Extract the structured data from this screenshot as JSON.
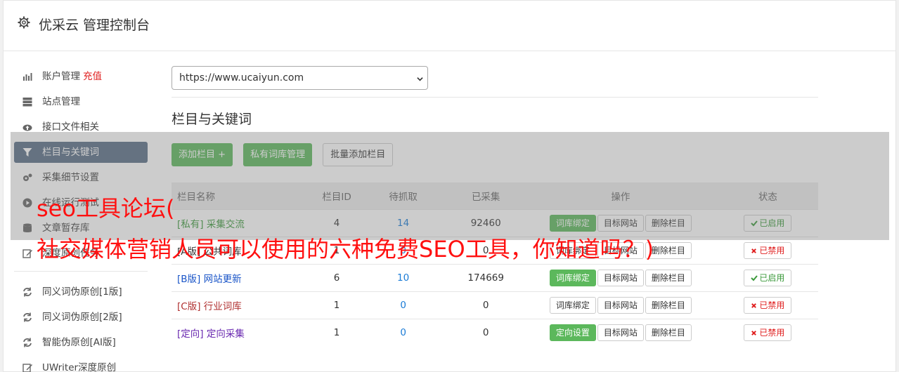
{
  "app": {
    "title": "优采云 管理控制台",
    "icon": "gear-icon"
  },
  "sidebar": {
    "items": [
      {
        "label": "账户管理",
        "extra": "充值",
        "icon": "bar-chart-icon"
      },
      {
        "label": "站点管理",
        "icon": "server-icon"
      },
      {
        "label": "接口文件相关",
        "icon": "cloud-upload-icon"
      },
      {
        "label": "栏目与关键词",
        "icon": "filter-icon",
        "active": true
      },
      {
        "label": "采集细节设置",
        "icon": "gears-icon"
      },
      {
        "label": "在线运行测试",
        "icon": "play-circle-icon"
      },
      {
        "label": "文章暂存库",
        "icon": "database-icon"
      },
      {
        "label": "深度原创任务",
        "icon": "edit-icon"
      }
    ],
    "tools": [
      {
        "label": "同义词伪原创[1版]",
        "icon": "refresh-icon"
      },
      {
        "label": "同义词伪原创[2版]",
        "icon": "refresh-icon"
      },
      {
        "label": "智能伪原创[AI版]",
        "icon": "refresh-icon"
      },
      {
        "label": "UWriter深度原创",
        "icon": "edit-icon"
      }
    ]
  },
  "main": {
    "site_select": "https://www.ucaiyun.com",
    "heading": "栏目与关键词",
    "buttons": {
      "add": "添加栏目 +",
      "private": "私有词库管理",
      "batch": "批量添加栏目"
    },
    "table": {
      "headers": [
        "栏目名称",
        "栏目ID",
        "待抓取",
        "已采集",
        "操作",
        "状态"
      ],
      "rows": [
        {
          "tag": "[私有]",
          "name": "采集交流",
          "id": "4",
          "pending": "14",
          "collected": "92460",
          "op1": "词库绑定",
          "op2": "目标网站",
          "op3": "删除栏目",
          "status": "已启用",
          "status_on": true,
          "op1_green": true,
          "color": "#3c9a3c"
        },
        {
          "tag": "[A版]",
          "name": "公共词库",
          "id": "1",
          "pending": "0",
          "collected": "0",
          "op1": "词库绑定",
          "op2": "目标网站",
          "op3": "删除栏目",
          "status": "已禁用",
          "status_on": false,
          "op1_green": false,
          "color": "#333333"
        },
        {
          "tag": "[B版]",
          "name": "网站更新",
          "id": "6",
          "pending": "10",
          "collected": "174669",
          "op1": "词库绑定",
          "op2": "目标网站",
          "op3": "删除栏目",
          "status": "已启用",
          "status_on": true,
          "op1_green": true,
          "color": "#1a55c8"
        },
        {
          "tag": "[C版]",
          "name": "行业词库",
          "id": "1",
          "pending": "0",
          "collected": "0",
          "op1": "词库绑定",
          "op2": "目标网站",
          "op3": "删除栏目",
          "status": "已禁用",
          "status_on": false,
          "op1_green": false,
          "color": "#b03030"
        },
        {
          "tag": "[定向]",
          "name": "定向采集",
          "id": "1",
          "pending": "0",
          "collected": "0",
          "op1": "定向设置",
          "op2": "目标网站",
          "op3": "删除栏目",
          "status": "已禁用",
          "status_on": false,
          "op1_green": true,
          "color": "#6a2ab0"
        }
      ]
    }
  },
  "overlay": {
    "line1": "seo工具论坛(",
    "line2": "社交媒体营销人员可以使用的六种免费SEO工具，你知道吗？)",
    "text_color": "#ff1010"
  }
}
